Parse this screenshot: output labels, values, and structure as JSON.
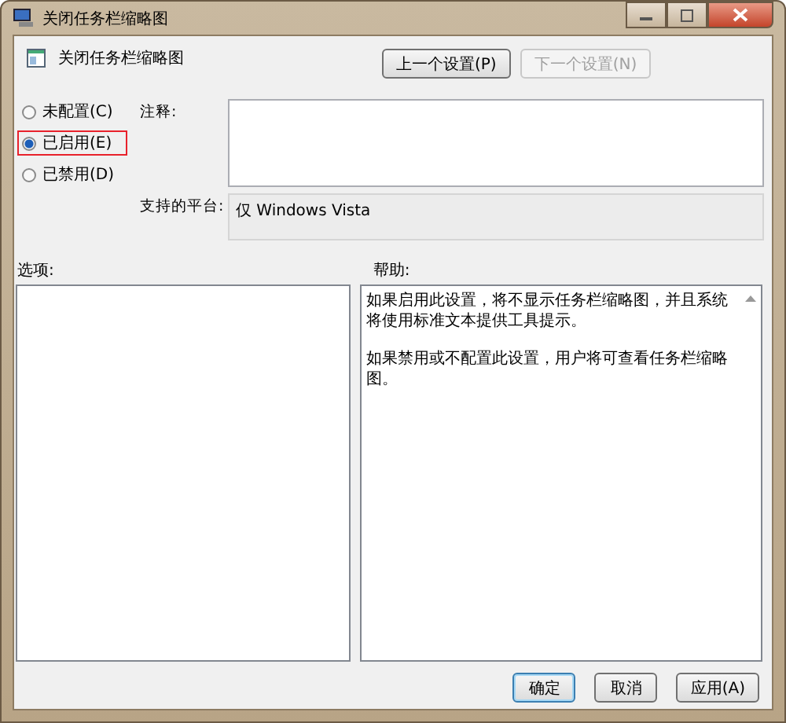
{
  "window": {
    "title": "关闭任务栏缩略图"
  },
  "header": {
    "title": "关闭任务栏缩略图",
    "buttons": [
      {
        "label": "上一个设置(P)",
        "disabled": false
      },
      {
        "label": "下一个设置(N)",
        "disabled": true
      }
    ]
  },
  "options": [
    {
      "label": "未配置(C)",
      "selected": false,
      "highlighted": false
    },
    {
      "label": "已启用(E)",
      "selected": true,
      "highlighted": true
    },
    {
      "label": "已禁用(D)",
      "selected": false,
      "highlighted": false
    }
  ],
  "comment": {
    "label": "注释:"
  },
  "platform": {
    "label": "支持的平台:",
    "value": "仅 Windows Vista"
  },
  "options_panel": {
    "label": "选项:"
  },
  "help": {
    "label": "帮助:",
    "paragraphs": [
      "如果启用此设置，将不显示任务栏缩略图，并且系统将使用标准文本提供工具提示。",
      "如果禁用或不配置此设置，用户将可查看任务栏缩略图。"
    ]
  },
  "buttons": [
    {
      "label": "确定",
      "default": true
    },
    {
      "label": "取消",
      "default": false
    },
    {
      "label": "应用(A)",
      "default": false
    }
  ]
}
